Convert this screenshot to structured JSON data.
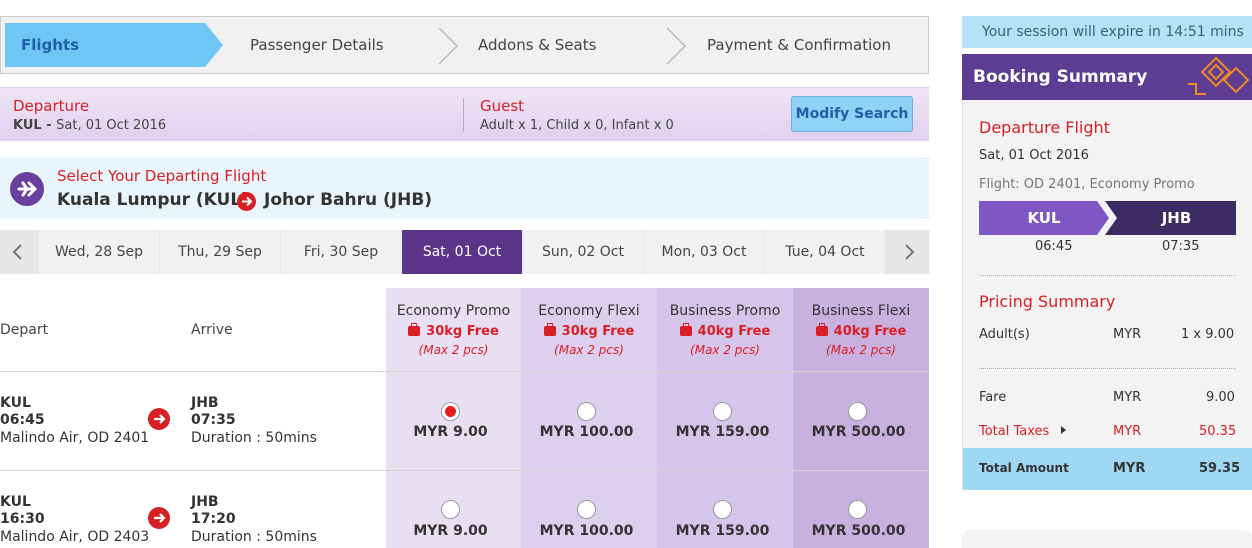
{
  "steps": [
    "Flights",
    "Passenger Details",
    "Addons & Seats",
    "Payment & Confirmation"
  ],
  "search": {
    "departure_label": "Departure",
    "departure_code": "KUL - ",
    "departure_date": "Sat, 01 Oct 2016",
    "guest_label": "Guest",
    "guest_value": "Adult x 1, Child x 0, Infant x 0",
    "modify_label": "Modify Search"
  },
  "route": {
    "select_label": "Select Your Departing Flight",
    "origin": "Kuala Lumpur (KUL)",
    "destination": "Johor Bahru (JHB)"
  },
  "dates": [
    "Wed, 28 Sep",
    "Thu, 29 Sep",
    "Fri, 30 Sep",
    "Sat, 01 Oct",
    "Sun, 02 Oct",
    "Mon, 03 Oct",
    "Tue, 04 Oct"
  ],
  "table": {
    "depart_header": "Depart",
    "arrive_header": "Arrive",
    "fares": [
      {
        "name": "Economy Promo",
        "bag": "30kg Free",
        "max": "(Max 2 pcs)"
      },
      {
        "name": "Economy Flexi",
        "bag": "30kg Free",
        "max": "(Max 2 pcs)"
      },
      {
        "name": "Business Promo",
        "bag": "40kg Free",
        "max": "(Max 2 pcs)"
      },
      {
        "name": "Business Flexi",
        "bag": "40kg Free",
        "max": "(Max 2 pcs)"
      }
    ],
    "flights": [
      {
        "dep_code": "KUL",
        "dep_time": "06:45",
        "carrier": "Malindo Air, OD 2401",
        "arr_code": "JHB",
        "arr_time": "07:35",
        "duration": "Duration : 50mins",
        "prices": [
          "MYR 9.00",
          "MYR 100.00",
          "MYR 159.00",
          "MYR 500.00"
        ]
      },
      {
        "dep_code": "KUL",
        "dep_time": "16:30",
        "carrier": "Malindo Air, OD 2403",
        "arr_code": "JHB",
        "arr_time": "17:20",
        "duration": "Duration : 50mins",
        "prices": [
          "MYR 9.00",
          "MYR 100.00",
          "MYR 159.00",
          "MYR 500.00"
        ]
      }
    ]
  },
  "sidebar": {
    "session": "Your session will expire in 14:51 mins",
    "title": "Booking Summary",
    "departure_flight_title": "Departure Flight",
    "date": "Sat, 01 Oct 2016",
    "flight_info": "Flight: OD 2401, Economy Promo",
    "from": "KUL",
    "to": "JHB",
    "from_time": "06:45",
    "to_time": "07:35",
    "pricing_title": "Pricing Summary",
    "adult_label": "Adult(s)",
    "currency": "MYR",
    "adult_value": "1 x 9.00",
    "fare_label": "Fare",
    "fare_value": "9.00",
    "taxes_label": "Total Taxes",
    "taxes_value": "50.35",
    "total_label": "Total Amount",
    "total_value": "59.35"
  },
  "colors": {
    "brand_purple": "#5c3d93",
    "accent_red": "#d91f26",
    "sky_blue": "#6ec6f7"
  }
}
